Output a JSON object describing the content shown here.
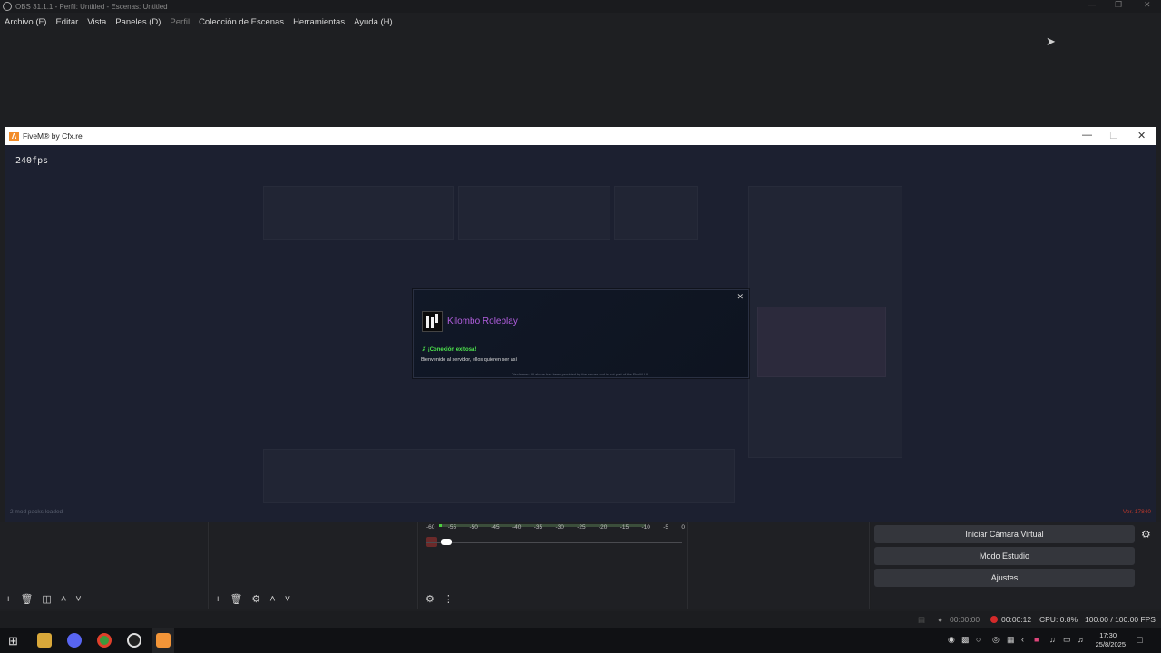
{
  "obs": {
    "window_title": "OBS 31.1.1 - Perfil: Untitled - Escenas: Untitled",
    "menu": [
      {
        "label": "Archivo (F)",
        "enabled": true
      },
      {
        "label": "Editar",
        "enabled": true
      },
      {
        "label": "Vista",
        "enabled": true
      },
      {
        "label": "Paneles (D)",
        "enabled": true
      },
      {
        "label": "Perfil",
        "enabled": false
      },
      {
        "label": "Colección de Escenas",
        "enabled": true
      },
      {
        "label": "Herramientas",
        "enabled": true
      },
      {
        "label": "Ayuda (H)",
        "enabled": true
      }
    ],
    "controls": {
      "virtual_camera": "Iniciar Cámara Virtual",
      "studio_mode": "Modo Estudio",
      "settings": "Ajustes"
    },
    "mixer": {
      "scale": [
        "-60",
        "-55",
        "-50",
        "-45",
        "-40",
        "-35",
        "-30",
        "-25",
        "-20",
        "-15",
        "-10",
        "-5",
        "0"
      ]
    },
    "status": {
      "stream_time": "00:00:00",
      "rec_time": "00:00:12",
      "cpu": "CPU: 0.8%",
      "fps": "100.00 / 100.00 FPS"
    }
  },
  "fivem": {
    "window_title": "FiveM® by Cfx.re",
    "fps_counter": "240fps",
    "mods_loaded": "2 mod packs loaded",
    "version": "Ver. 17840",
    "dialog": {
      "server_name": "Kilombo Roleplay",
      "status": "¡Conexión exitosa!",
      "welcome": "Bienvenido al servidor, ellos quieren ser así",
      "disclaimer": "Disclaimer: UI above has been provided by the server and is not part of the FiveM UI."
    }
  },
  "taskbar": {
    "time": "17:30",
    "date": "25/8/2025"
  },
  "colors": {
    "obs_bg": "#1e1f22",
    "fivem_bg": "#1c2030",
    "server_name": "#b35fe0",
    "success": "#4ee64e",
    "record": "#d42a2a"
  }
}
